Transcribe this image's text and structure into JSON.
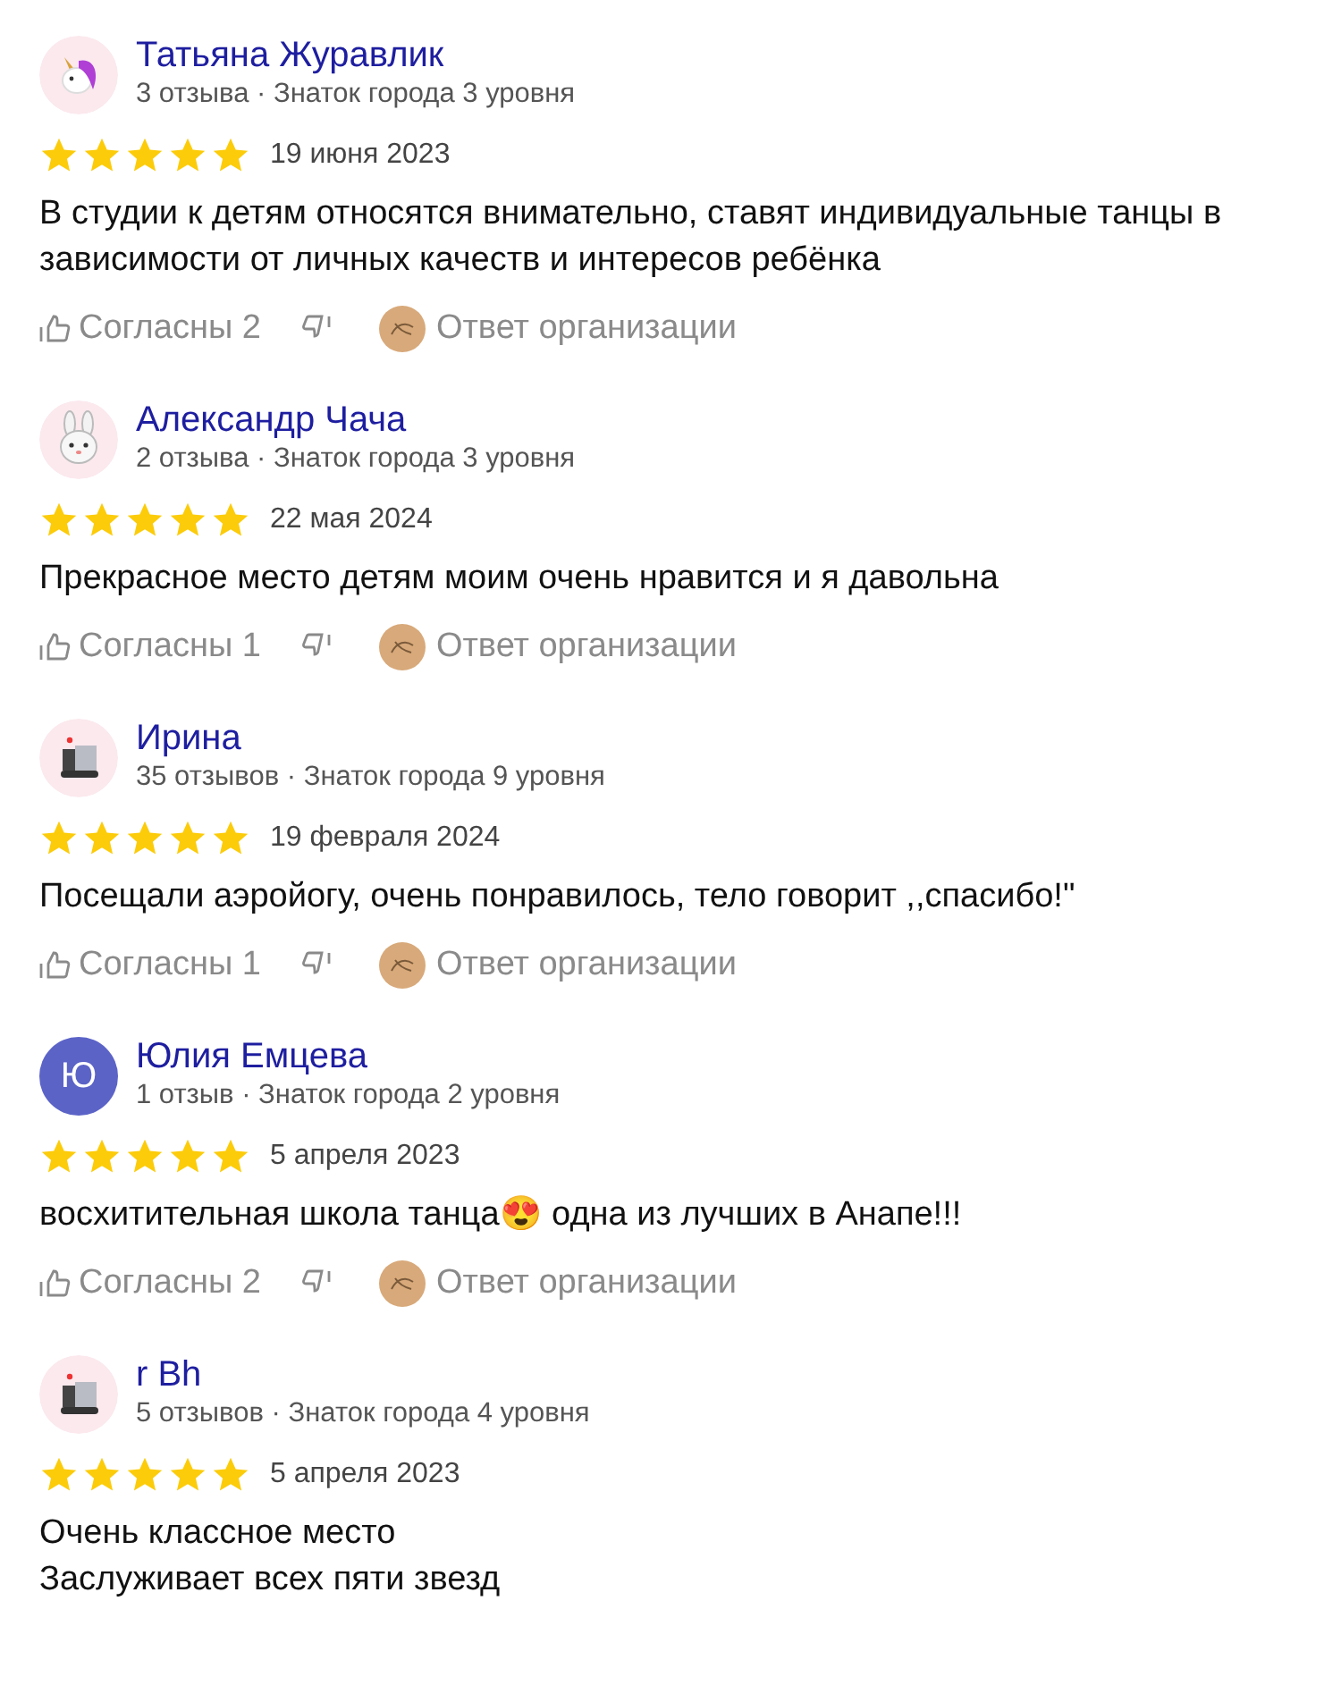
{
  "reviews": [
    {
      "avatar": {
        "kind": "unicorn"
      },
      "name": "Татьяна Журавлик",
      "meta": "3 отзыва · Знаток города 3 уровня",
      "stars": 5,
      "date": "19 июня 2023",
      "text": [
        "В студии к детям относятся внимательно, ставят индивидуальные танцы в зависимости от личных качеств и интересов ребёнка"
      ],
      "actions": {
        "agree": "Согласны 2",
        "reply": "Ответ организации"
      }
    },
    {
      "avatar": {
        "kind": "bunny"
      },
      "name": "Александр Чача",
      "meta": "2 отзыва · Знаток города 3 уровня",
      "stars": 5,
      "date": "22 мая 2024",
      "text": [
        "Прекрасное место детям моим очень нравится и я давольна"
      ],
      "actions": {
        "agree": "Согласны 1",
        "reply": "Ответ организации"
      }
    },
    {
      "avatar": {
        "kind": "robot"
      },
      "name": "Ирина",
      "meta": "35 отзывов · Знаток города 9 уровня",
      "stars": 5,
      "date": "19 февраля 2024",
      "text": [
        "Посещали аэройогу, очень понравилось, тело говорит ,,спасибо!\""
      ],
      "actions": {
        "agree": "Согласны 1",
        "reply": "Ответ организации"
      }
    },
    {
      "avatar": {
        "kind": "letter",
        "letter": "Ю",
        "color": "#5b63c7"
      },
      "name": "Юлия Емцева",
      "meta": "1 отзыв · Знаток города 2 уровня",
      "stars": 5,
      "date": "5 апреля 2023",
      "text": [
        "восхитительная школа танца😍 одна из лучших в Анапе!!!"
      ],
      "actions": {
        "agree": "Согласны 2",
        "reply": "Ответ организации"
      }
    },
    {
      "avatar": {
        "kind": "robot"
      },
      "name": "r Bh",
      "meta": "5 отзывов · Знаток города 4 уровня",
      "stars": 5,
      "date": "5 апреля 2023",
      "text": [
        "Очень классное место",
        "Заслуживает всех пяти звезд"
      ]
    }
  ]
}
